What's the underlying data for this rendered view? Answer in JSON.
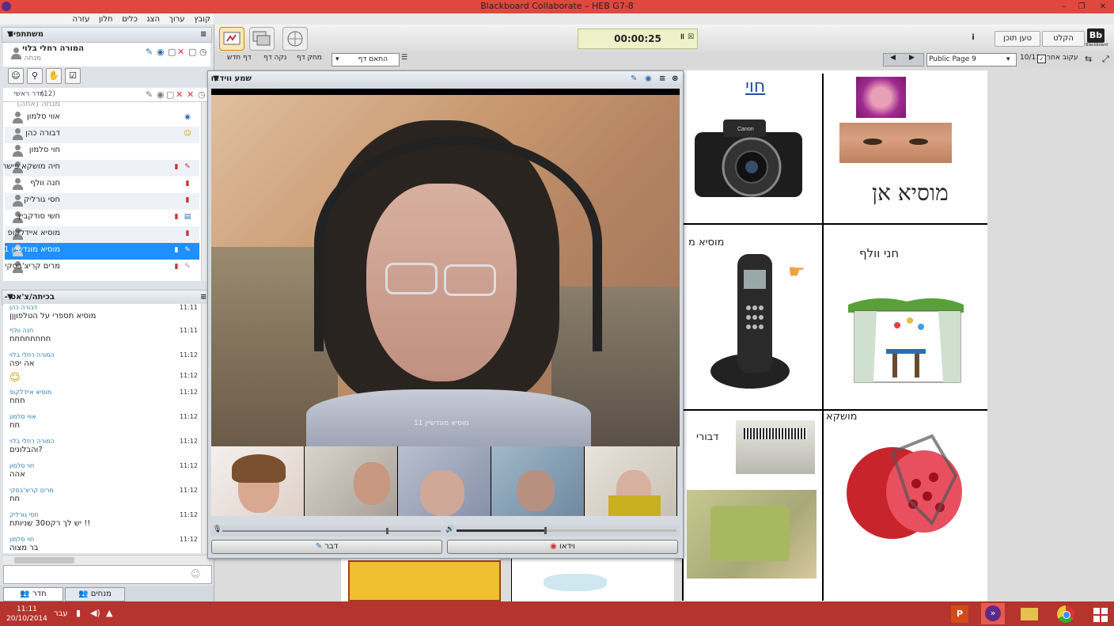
{
  "window": {
    "title": "Blackboard Collaborate – HEB G7-8"
  },
  "menu": [
    "קובץ",
    "ערוך",
    "הצג",
    "כלים",
    "חלון",
    "עזרה"
  ],
  "participants_panel": {
    "title": "משתתפים",
    "me": {
      "name": "המורה רחלי בלוי",
      "role": "מנחה"
    },
    "room_label": "חדר ראשי",
    "room_count": "(12)",
    "moderator_row": "מנחה (אתה)",
    "list": [
      {
        "name": "אווי סלמון",
        "status": "webcam"
      },
      {
        "name": "דבורה כהן",
        "status": "emoticon"
      },
      {
        "name": "חוי סלמון",
        "status": ""
      },
      {
        "name": "חיה מושקא פישר",
        "status": "whiteboard"
      },
      {
        "name": "חנה וולף",
        "status": "mic"
      },
      {
        "name": "חסי גורליק",
        "status": "mic"
      },
      {
        "name": "חשי סודקביץ",
        "status": "chat"
      },
      {
        "name": "מוסיא איידלקופ",
        "status": "mic"
      },
      {
        "name": "מוסיא מונדשיין 11",
        "status": "whiteboard",
        "selected": true
      },
      {
        "name": "מרים קריצ'בסקי",
        "status": "whiteboard"
      }
    ]
  },
  "chat_panel": {
    "title": "בכיתה/צ'אט -",
    "messages": [
      {
        "who": "דבורה כהן",
        "time": "11:11",
        "text": "מוסיא תספרי על הטלפוןןן"
      },
      {
        "who": "חנה וולף",
        "time": "11:11",
        "text": "חחחחחחחח"
      },
      {
        "who": "המורה רחלי בלוי",
        "time": "11:12",
        "text": "אה יפה"
      },
      {
        "who": "",
        "time": "11:12",
        "text": "☺"
      },
      {
        "who": "מוסיא איידלקופ",
        "time": "11:12",
        "text": "חחח"
      },
      {
        "who": "אווי סלמון",
        "time": "11:12",
        "text": "חח"
      },
      {
        "who": "המורה רחלי בלוי",
        "time": "11:12",
        "text": "?והבלונים"
      },
      {
        "who": "חוי סלמון",
        "time": "11:12",
        "text": "אהה"
      },
      {
        "who": "מרים קריצ'בסקי",
        "time": "11:12",
        "text": "חח"
      },
      {
        "who": "חסי גורליק",
        "time": "11:12",
        "text": "!! יש לך רקס30 שניותת"
      },
      {
        "who": "חוי סלמון",
        "time": "11:12",
        "text": "בר מצוה"
      }
    ],
    "input_placeholder": ""
  },
  "bottom_tabs": {
    "room": "חדר",
    "moderators": "מנחים"
  },
  "toolbar": {
    "timer": "00:00:25",
    "load_content": "טען תוכן",
    "record": "הקלט",
    "brand": "Blackboard",
    "follow": "עקוב אחר",
    "page_count": "10/11",
    "page_select": "Public Page 9",
    "new_page": "דף חדש",
    "clear_page": "נקה דף",
    "delete_page": "מחק דף",
    "zoom": "התאם דף"
  },
  "video": {
    "title": "שמע ווידאו",
    "speaker_label": "מוסיא מונדשיין 11",
    "talk_button": "דבר",
    "video_button": "וידאו",
    "volume_level": 0.4,
    "mic_level": 0.75
  },
  "whiteboard": {
    "labels": {
      "cell1": "חוי",
      "cell2_handwriting": "מוסיא אן",
      "cell3": "מוסיא מ",
      "cell4": "חני וולף",
      "cell5": "דבורי",
      "cell6": "מושקא"
    },
    "icons": [
      "camera-image",
      "baby-photo",
      "eyes-photo",
      "phone-image",
      "pointing-hand-icon",
      "sukkah-image",
      "card-photo",
      "pomegranate-image"
    ]
  },
  "taskbar": {
    "time": "11:11",
    "date": "20/10/2014",
    "lang": "עבר"
  },
  "colors": {
    "titlebar": "#e0483f",
    "selected": "#1e90ff",
    "taskbar": "#b5342d"
  }
}
